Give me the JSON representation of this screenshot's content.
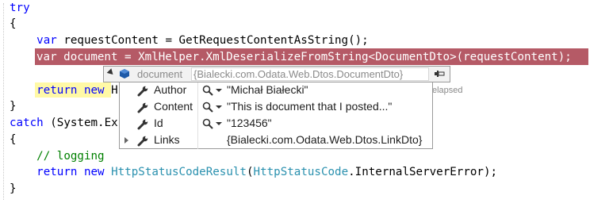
{
  "code": {
    "l1": "try",
    "l2": "{",
    "l3_kw": "var",
    "l3_rest": " requestContent = GetRequestContentAsString();",
    "l4_kw": "var",
    "l4_a": " document = ",
    "l4_type": "XmlHelper",
    "l4_b": ".XmlDeserializeFromString<",
    "l4_type2": "DocumentDto",
    "l4_c": ">(requestContent);",
    "l5_kw1": "return",
    "l5_kw2": "new",
    "l5_rest": " H",
    "l6": "}",
    "l7_kw": "catch",
    "l7_rest": " (System.Ex",
    "l8": "{",
    "l9": "// logging",
    "l10_kw1": "return",
    "l10_kw2": "new",
    "l10_type": "HttpStatusCodeResult",
    "l10_a": "(",
    "l10_type2": "HttpStatusCode",
    "l10_b": ".InternalServerError);",
    "l11": "}"
  },
  "elapsed_text": "elapsed",
  "datatip": {
    "name": "document",
    "value": "{Bialecki.com.Odata.Web.Dtos.DocumentDto}",
    "rows": [
      {
        "label": "Author",
        "value": "\"Michał Białecki\""
      },
      {
        "label": "Content",
        "value": "\"This is document that I posted...\""
      },
      {
        "label": "Id",
        "value": "\"123456\""
      },
      {
        "label": "Links",
        "value": "{Bialecki.com.Odata.Web.Dtos.LinkDto}"
      }
    ]
  },
  "colors": {
    "keyword": "#0000ff",
    "type": "#2b91af",
    "comment": "#008000",
    "breakpoint_line": "#b55a66",
    "current_statement": "#fff9a6"
  },
  "icons": {
    "object": "object-cube-icon",
    "property": "wrench-icon",
    "visualizer": "magnifier-icon",
    "pin": "pin-icon"
  }
}
